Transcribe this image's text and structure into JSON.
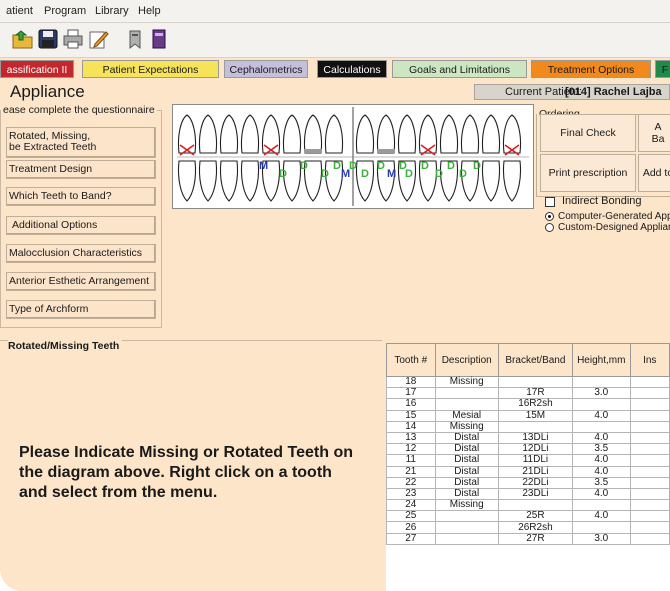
{
  "menu": {
    "items": [
      "atient",
      "Program",
      "Library",
      "Help"
    ]
  },
  "toolbar": {
    "icons": [
      "open-folder-icon",
      "save-disk-icon",
      "print-icon",
      "edit-icon",
      "bookmark-icon",
      "book-icon"
    ]
  },
  "tabs": [
    {
      "label": "assification II",
      "bg": "#c1272d",
      "fg": "#ffffff"
    },
    {
      "label": "Patient Expectations",
      "bg": "#f6e35a",
      "fg": "#1a1a1a"
    },
    {
      "label": "Cephalometrics",
      "bg": "#c4c0dc",
      "fg": "#1a1a1a"
    },
    {
      "label": "Calculations",
      "bg": "#111111",
      "fg": "#ffffff"
    },
    {
      "label": "Goals and Limitations",
      "bg": "#cbe6c1",
      "fg": "#1a1a1a"
    },
    {
      "label": "Treatment Options",
      "bg": "#f08a1e",
      "fg": "#1a1a1a"
    },
    {
      "label": "F",
      "bg": "#1f8a4a",
      "fg": "#1a1a1a"
    }
  ],
  "page": {
    "title": "Appliance"
  },
  "current_patient": {
    "label": "Current Patient:",
    "value": "[014] Rachel Lajba"
  },
  "questionnaire": {
    "legend": "ease complete the questionnaire",
    "items": [
      "Rotated, Missing,\n be Extracted Teeth",
      "Treatment Design",
      "Which Teeth to Band?",
      "Additional Options",
      "Malocclusion Characteristics",
      "Anterior Esthetic Arrangement",
      "Type of  Archform"
    ]
  },
  "ordering": {
    "legend": "Ordering",
    "final_check": "Final Check",
    "add_bands": "A\nBa",
    "print_prescription": "Print prescription",
    "add_to": "Add to",
    "indirect_bonding": "Indirect Bonding",
    "radio_computer": "Computer-Generated App",
    "radio_custom": "Custom-Designed Applian"
  },
  "rotated_missing": {
    "legend": "Rotated/Missing Teeth",
    "instruction": "Please Indicate Missing or Rotated Teeth on the diagram above. Right click on a tooth and select from the menu."
  },
  "teeth_table": {
    "headers": [
      "Tooth #",
      "Description",
      "Bracket/Band",
      "Height,mm",
      "Ins"
    ],
    "rows": [
      [
        "18",
        "Missing",
        "",
        ""
      ],
      [
        "17",
        "",
        "17R",
        "3.0"
      ],
      [
        "16",
        "",
        "16R2sh",
        ""
      ],
      [
        "15",
        "Mesial",
        "15M",
        "4.0"
      ],
      [
        "14",
        "Missing",
        "",
        ""
      ],
      [
        "13",
        "Distal",
        "13DLi",
        "4.0"
      ],
      [
        "12",
        "Distal",
        "12DLi",
        "3.5"
      ],
      [
        "11",
        "Distal",
        "11DLi",
        "4.0"
      ],
      [
        "21",
        "Distal",
        "21DLi",
        "4.0"
      ],
      [
        "22",
        "Distal",
        "22DLi",
        "3.5"
      ],
      [
        "23",
        "Distal",
        "23DLi",
        "4.0"
      ],
      [
        "24",
        "Missing",
        "",
        ""
      ],
      [
        "25",
        "",
        "25R",
        "4.0"
      ],
      [
        "26",
        "",
        "26R2sh",
        ""
      ],
      [
        "27",
        "",
        "27R",
        "3.0"
      ]
    ]
  },
  "diagram": {
    "letters": [
      "M",
      "D",
      "D",
      "D",
      "D",
      "M",
      "D",
      "D",
      "D",
      "M",
      "D",
      "D",
      "D",
      "D",
      "D",
      "D",
      "D"
    ]
  }
}
